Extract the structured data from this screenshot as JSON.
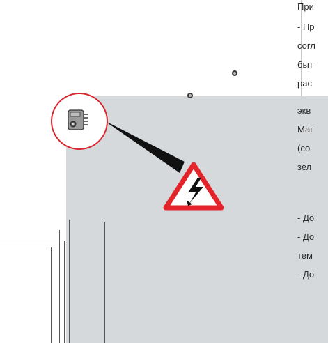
{
  "text_lines": [
    "При",
    "- Пр",
    "согл",
    "быт",
    "рас",
    "экв",
    "Маг",
    "(со",
    "зел",
    "- До",
    "- До",
    "тем",
    "- До"
  ],
  "colors": {
    "panel": "#d6d9dc",
    "warning_red": "#e3242b",
    "circle_red": "#d9262e",
    "text": "#2a2a2a"
  },
  "icons": {
    "warning": "electrical-hazard-warning-icon",
    "connector": "terminal-connector-icon",
    "screw": "screw-icon"
  }
}
